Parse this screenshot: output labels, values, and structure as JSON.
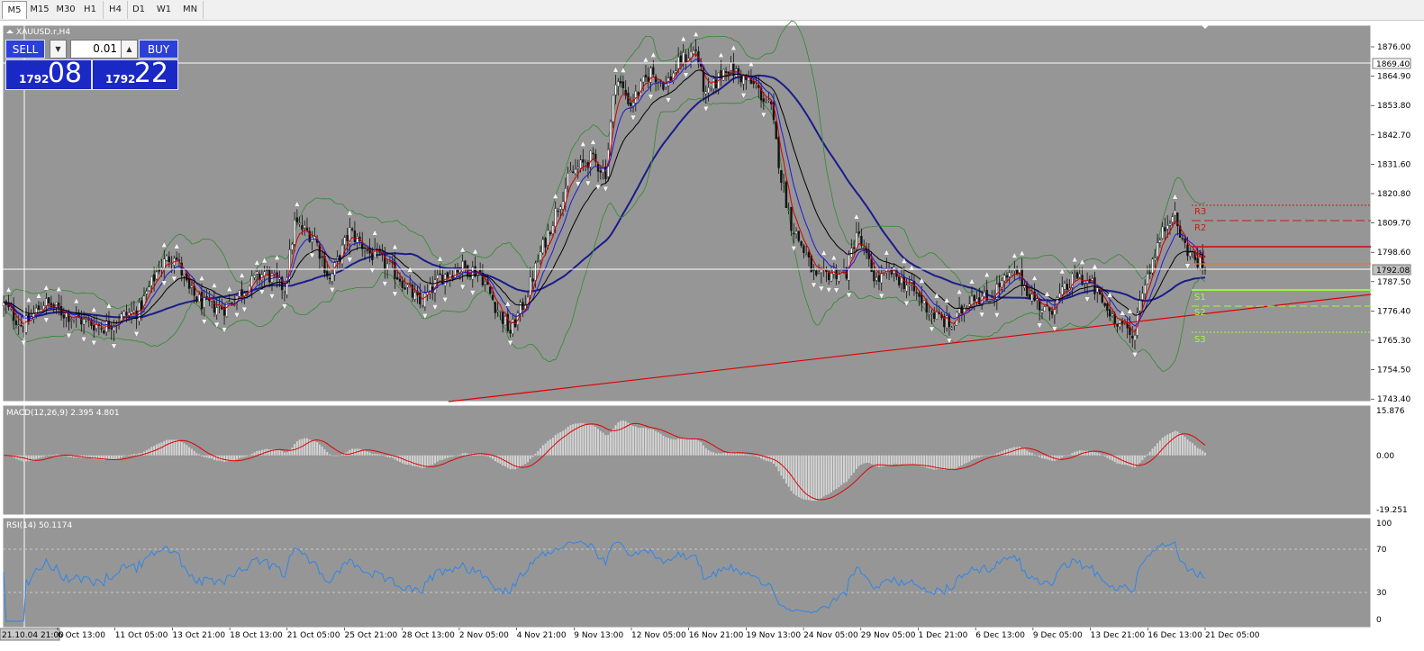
{
  "timeframes": [
    "M5",
    "M15",
    "M30",
    "H1",
    "H4",
    "D1",
    "W1",
    "MN"
  ],
  "active_timeframe": "M5",
  "symbol_label": "XAUUSD.r,H4",
  "trade_panel": {
    "sell_label": "SELL",
    "buy_label": "BUY",
    "lot_value": "0.01",
    "sell_price_small": "1792",
    "sell_price_big": "08",
    "buy_price_small": "1792",
    "buy_price_big": "22"
  },
  "colors": {
    "chart_bg": "#969696",
    "grid_white": "#ffffff",
    "ma_fast": "#d40000",
    "ma_mid": "#1a1ad8",
    "ma_slow": "#000000",
    "ma_long": "#1b1b8c",
    "bollinger": "#2e8b2e",
    "macd_signal": "#e00000",
    "macd_hist": "#d4d4d4",
    "rsi_line": "#2f86e8",
    "pivot_r": "#c81b1b",
    "pivot_s": "#9aff3c"
  },
  "price_axis": {
    "labels": [
      "1876.00",
      "1864.90",
      "1853.80",
      "1842.70",
      "1831.60",
      "1820.80",
      "1809.70",
      "1798.60",
      "1787.50",
      "1776.40",
      "1765.30",
      "1754.50",
      "1743.40"
    ],
    "highlight_upper": "1869.40",
    "highlight_current": "1792.08"
  },
  "pivots": {
    "r3": "R3",
    "r2": "R2",
    "r1": "R1",
    "s1": "S1",
    "s2": "S2",
    "s3": "S3"
  },
  "macd": {
    "label": "MACD(12,26,9) 2.395 4.801",
    "axis_labels": [
      "15.876",
      "0.00",
      "-19.251"
    ]
  },
  "rsi": {
    "label": "RSI(14) 50.1174",
    "axis_labels": [
      "100",
      "70",
      "30",
      "0"
    ]
  },
  "time_axis": {
    "first_label": "21.10.04 21:00",
    "labels": [
      "6 Oct 13:00",
      "11 Oct 05:00",
      "13 Oct 21:00",
      "18 Oct 13:00",
      "21 Oct 05:00",
      "25 Oct 21:00",
      "28 Oct 13:00",
      "2 Nov 05:00",
      "4 Nov 21:00",
      "9 Nov 13:00",
      "12 Nov 05:00",
      "16 Nov 21:00",
      "19 Nov 13:00",
      "24 Nov 05:00",
      "29 Nov 05:00",
      "1 Dec 21:00",
      "6 Dec 13:00",
      "9 Dec 05:00",
      "13 Dec 21:00",
      "16 Dec 13:00",
      "21 Dec 05:00"
    ]
  },
  "chart_data": {
    "type": "candlestick",
    "symbol": "XAUUSD.r",
    "timeframe": "H4",
    "ylim": [
      1743.4,
      1880
    ],
    "keypoints_price": [
      [
        0,
        1778
      ],
      [
        8,
        1770
      ],
      [
        16,
        1779
      ],
      [
        24,
        1775
      ],
      [
        32,
        1772
      ],
      [
        40,
        1770
      ],
      [
        48,
        1774
      ],
      [
        54,
        1776
      ],
      [
        62,
        1792
      ],
      [
        68,
        1797
      ],
      [
        74,
        1783
      ],
      [
        80,
        1778
      ],
      [
        88,
        1777
      ],
      [
        96,
        1784
      ],
      [
        104,
        1790
      ],
      [
        112,
        1784
      ],
      [
        116,
        1808
      ],
      [
        124,
        1803
      ],
      [
        130,
        1787
      ],
      [
        138,
        1805
      ],
      [
        146,
        1797
      ],
      [
        150,
        1795
      ],
      [
        158,
        1788
      ],
      [
        166,
        1778
      ],
      [
        174,
        1788
      ],
      [
        182,
        1792
      ],
      [
        190,
        1790
      ],
      [
        196,
        1778
      ],
      [
        202,
        1768
      ],
      [
        208,
        1780
      ],
      [
        214,
        1797
      ],
      [
        220,
        1812
      ],
      [
        226,
        1826
      ],
      [
        234,
        1832
      ],
      [
        240,
        1827
      ],
      [
        244,
        1862
      ],
      [
        250,
        1852
      ],
      [
        258,
        1864
      ],
      [
        264,
        1859
      ],
      [
        270,
        1868
      ],
      [
        276,
        1872
      ],
      [
        280,
        1854
      ],
      [
        288,
        1866
      ],
      [
        294,
        1862
      ],
      [
        300,
        1858
      ],
      [
        306,
        1850
      ],
      [
        310,
        1825
      ],
      [
        314,
        1808
      ],
      [
        318,
        1800
      ],
      [
        324,
        1787
      ],
      [
        330,
        1790
      ],
      [
        336,
        1790
      ],
      [
        340,
        1805
      ],
      [
        344,
        1795
      ],
      [
        348,
        1787
      ],
      [
        354,
        1790
      ],
      [
        362,
        1784
      ],
      [
        370,
        1775
      ],
      [
        378,
        1770
      ],
      [
        386,
        1782
      ],
      [
        392,
        1780
      ],
      [
        398,
        1786
      ],
      [
        404,
        1790
      ],
      [
        410,
        1781
      ],
      [
        416,
        1775
      ],
      [
        422,
        1782
      ],
      [
        428,
        1789
      ],
      [
        434,
        1785
      ],
      [
        440,
        1776
      ],
      [
        446,
        1771
      ],
      [
        450,
        1765
      ],
      [
        454,
        1784
      ],
      [
        460,
        1800
      ],
      [
        466,
        1813
      ],
      [
        470,
        1801
      ],
      [
        474,
        1796
      ],
      [
        478,
        1792
      ]
    ],
    "n_candles": 480,
    "macd": {
      "params": "12,26,9",
      "main": 2.395,
      "signal": 4.801,
      "ylim": [
        -19.251,
        15.876
      ]
    },
    "rsi": {
      "period": 14,
      "value": 50.1174,
      "levels": [
        30,
        70
      ],
      "ylim": [
        0,
        100
      ]
    }
  }
}
